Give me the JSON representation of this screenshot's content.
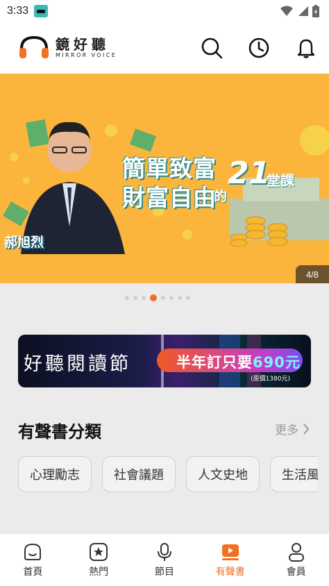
{
  "status_bar": {
    "time": "3:33"
  },
  "header": {
    "logo_cn": "鏡好聽",
    "logo_en": "MIRROR VOICE",
    "icons": [
      "search-icon",
      "history-icon",
      "bell-icon"
    ]
  },
  "banner": {
    "line1": "簡單致富",
    "line2": "財富自由",
    "number": "21",
    "suffix": "堂課",
    "de": "的",
    "person_name": "郝旭烈",
    "counter": "4/8",
    "background": "#fbb53c"
  },
  "carousel": {
    "total_dots": 8,
    "active_index": 3
  },
  "promo": {
    "title": "好聽閱讀節",
    "offer_prefix": "半年訂只要",
    "offer_price": "690元",
    "original_price": "(原價1380元)"
  },
  "category_section": {
    "title": "有聲書分類",
    "more_label": "更多",
    "chips": [
      "心理勵志",
      "社會議題",
      "人文史地",
      "生活風"
    ]
  },
  "tab_bar": {
    "active": "有聲書",
    "accent": "#f36f21",
    "tabs": [
      {
        "label": "首頁",
        "icon": "home-icon"
      },
      {
        "label": "熱門",
        "icon": "star-icon"
      },
      {
        "label": "節目",
        "icon": "microphone-icon"
      },
      {
        "label": "有聲書",
        "icon": "play-book-icon"
      },
      {
        "label": "會員",
        "icon": "user-icon"
      }
    ]
  }
}
